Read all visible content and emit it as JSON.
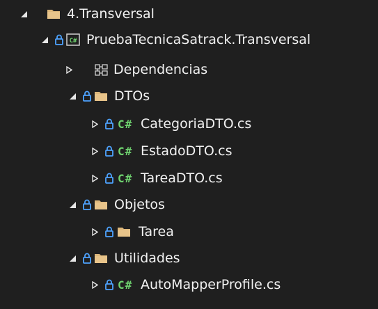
{
  "tree": {
    "root": {
      "label": "4.Transversal",
      "icon": "folder-icon",
      "state": "expanded"
    },
    "project": {
      "label": "PruebaTecnicaSatrack.Transversal",
      "icon": "csharp-project-icon",
      "state": "expanded"
    },
    "dependencies": {
      "label": "Dependencias",
      "icon": "dependencies-icon",
      "state": "collapsed"
    },
    "dtos": {
      "label": "DTOs",
      "icon": "folder-icon",
      "state": "expanded",
      "files": [
        {
          "label": "CategoriaDTO.cs"
        },
        {
          "label": "EstadoDTO.cs"
        },
        {
          "label": "TareaDTO.cs"
        }
      ]
    },
    "objetos": {
      "label": "Objetos",
      "icon": "folder-icon",
      "state": "expanded",
      "children": [
        {
          "label": "Tarea",
          "icon": "folder-icon",
          "state": "collapsed"
        }
      ]
    },
    "utilidades": {
      "label": "Utilidades",
      "icon": "folder-icon",
      "state": "expanded",
      "files": [
        {
          "label": "AutoMapperProfile.cs"
        }
      ]
    },
    "csharp_badge": "C#",
    "colors": {
      "background": "#1f1f1f",
      "text": "#f1f1f1",
      "folder": "#dcb67a",
      "lock": "#4ea3ff",
      "csharp": "#6fd36f"
    }
  }
}
